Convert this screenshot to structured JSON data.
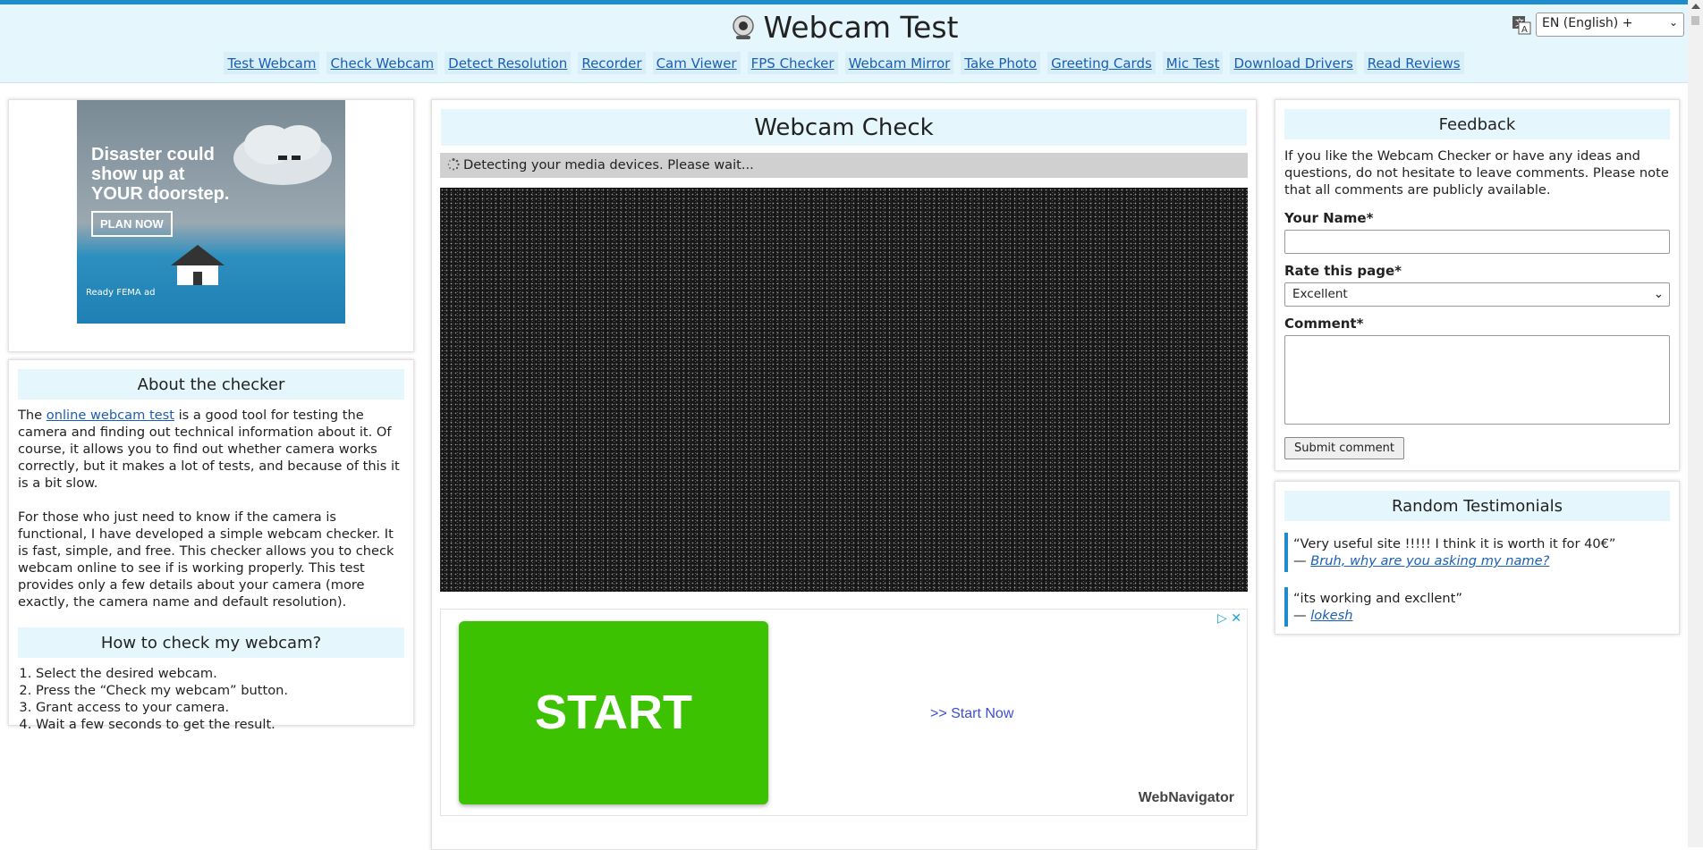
{
  "header": {
    "title": "Webcam Test",
    "nav": [
      "Test Webcam",
      "Check Webcam",
      "Detect Resolution",
      "Recorder",
      "Cam Viewer",
      "FPS Checker",
      "Webcam Mirror",
      "Take Photo",
      "Greeting Cards",
      "Mic Test",
      "Download Drivers",
      "Read Reviews"
    ],
    "language": "EN (English) +"
  },
  "ad_left": {
    "headline_1": "Disaster could",
    "headline_2": "show up at",
    "headline_3": "YOUR doorstep.",
    "button": "PLAN NOW",
    "footer": "Ready  FEMA  ad"
  },
  "about": {
    "title": "About the checker",
    "p1_before": "The ",
    "p1_link": "online webcam test",
    "p1_after": " is a good tool for testing the camera and finding out technical information about it. Of course, it allows you to find out whether camera works correctly, but it makes a lot of tests, and because of this it is a bit slow.",
    "p2": "For those who just need to know if the camera is functional, I have developed a simple webcam checker. It is fast, simple, and free. This checker allows you to check webcam online to see if is working properly. This test provides only a few details about your camera (more exactly, the camera name and default resolution)."
  },
  "howto": {
    "title": "How to check my webcam?",
    "steps": [
      "Select the desired webcam.",
      "Press the “Check my webcam” button.",
      "Grant access to your camera.",
      "Wait a few seconds to get the result."
    ]
  },
  "main": {
    "title": "Webcam Check",
    "status": "Detecting your media devices. Please wait..."
  },
  "promo": {
    "start": "START",
    "link": ">> Start Now",
    "brand": "WebNavigator",
    "close": "▷ ✕"
  },
  "feedback": {
    "title": "Feedback",
    "intro": "If you like the Webcam Checker or have any ideas and questions, do not hesitate to leave comments. Please note that all comments are publicly available.",
    "name_label": "Your Name*",
    "rate_label": "Rate this page*",
    "rate_value": "Excellent",
    "comment_label": "Comment*",
    "submit": "Submit comment"
  },
  "testimonials": {
    "title": "Random Testimonials",
    "items": [
      {
        "quote": "“Very useful site !!!!! I think it is worth it for 40€”",
        "author": "Bruh, why are you asking my name?"
      },
      {
        "quote": "“its working and excllent”",
        "author": "lokesh"
      }
    ]
  },
  "colors": {
    "accent": "#1e8ccc",
    "header_bg": "#e5f6fd",
    "link": "#1a5fb4",
    "start_green": "#3cc200"
  }
}
